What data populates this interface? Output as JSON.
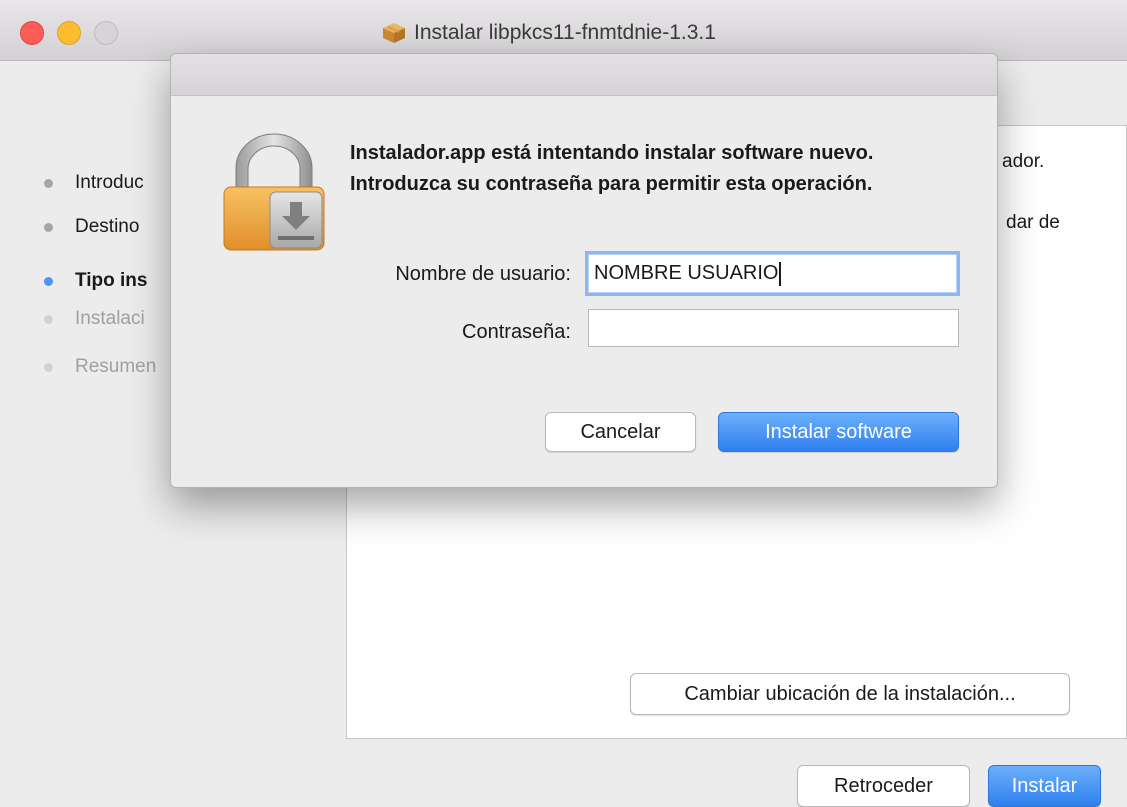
{
  "window": {
    "title": "Instalar libpkcs11-fnmtdnie-1.3.1"
  },
  "sidebar": {
    "items": [
      {
        "label": "Introduc",
        "state": "done"
      },
      {
        "label": "Destino",
        "state": "done"
      },
      {
        "label": "Tipo ins",
        "state": "active"
      },
      {
        "label": "Instalaci",
        "state": "future"
      },
      {
        "label": "Resumen",
        "state": "future"
      }
    ]
  },
  "panel": {
    "text_line_1": "ador.",
    "text_line_2": "dar de",
    "change_location_label": "Cambiar ubicación de la instalación..."
  },
  "footer": {
    "back_label": "Retroceder",
    "install_label": "Instalar"
  },
  "dialog": {
    "message": "Instalador.app está intentando instalar software nuevo. Introduzca su contraseña para permitir esta operación.",
    "username_label": "Nombre de usuario:",
    "username_value": "NOMBRE USUARIO",
    "password_label": "Contraseña:",
    "password_value": "",
    "cancel_label": "Cancelar",
    "confirm_label": "Instalar software"
  },
  "colors": {
    "accent": "#2f7fef",
    "active_step_dot": "#4f96ef",
    "close": "#fc5e57",
    "minimize": "#fdbc2e"
  }
}
